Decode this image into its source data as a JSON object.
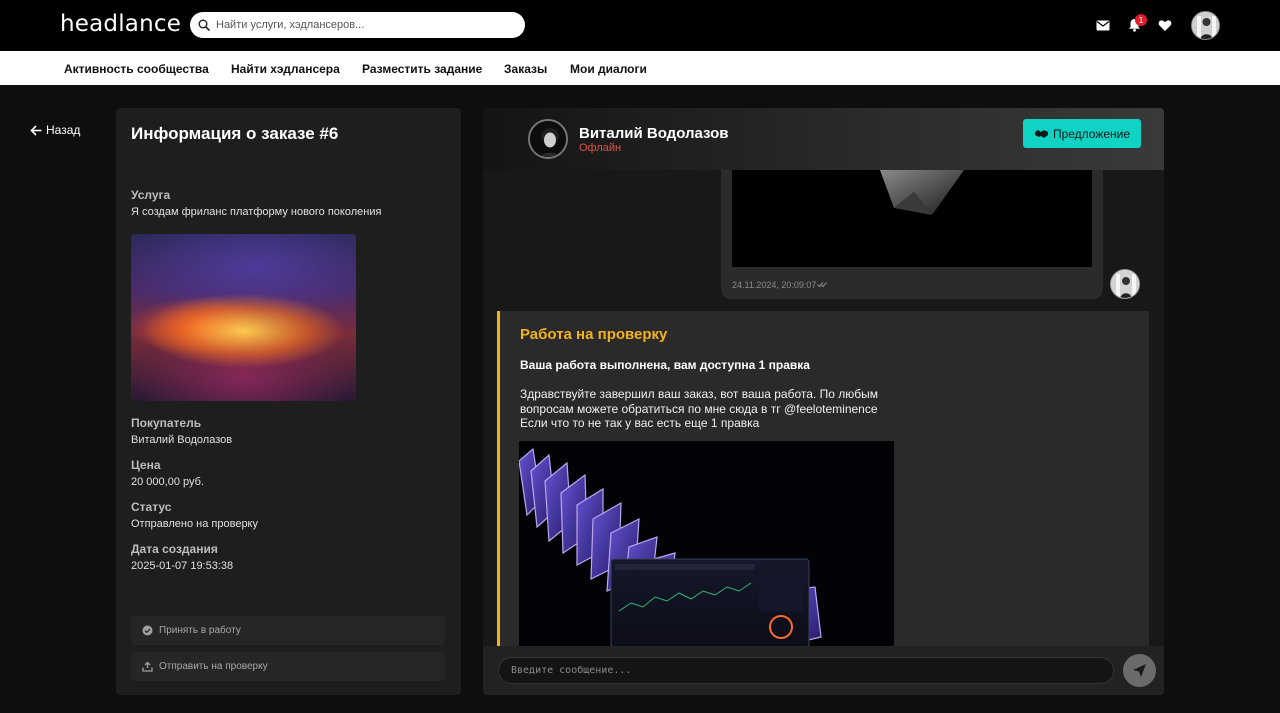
{
  "header": {
    "logo": "headlance",
    "search_placeholder": "Найти услуги, хэдлансеров...",
    "notification_count": "1",
    "icons": [
      "mail-icon",
      "bell-icon",
      "heart-icon",
      "user-avatar"
    ]
  },
  "nav": {
    "items": [
      {
        "label": "Активность сообщества"
      },
      {
        "label": "Найти хэдлансера"
      },
      {
        "label": "Разместить задание"
      },
      {
        "label": "Заказы"
      },
      {
        "label": "Мои диалоги"
      }
    ]
  },
  "back_label": "Назад",
  "order": {
    "title": "Информация о заказе #6",
    "service_label": "Услуга",
    "service_value": "Я создам фриланс платформу нового поколения",
    "buyer_label": "Покупатель",
    "buyer_value": "Виталий Водолазов",
    "price_label": "Цена",
    "price_value": "20 000,00 руб.",
    "status_label": "Статус",
    "status_value": "Отправлено на проверку",
    "date_label": "Дата создания",
    "date_value": "2025-01-07 19:53:38",
    "accept_button": "Принять в работу",
    "submit_button": "Отправить на проверку"
  },
  "chat": {
    "name": "Виталий Водолазов",
    "status": "Офлайн",
    "offer_button": "Предложение",
    "prev_message_time": "24.11.2024, 20:09:07",
    "review": {
      "title": "Работа на проверку",
      "subtitle": "Ваша работа выполнена, вам доступна 1 правка",
      "body_lines": [
        "Здравствуйте завершил ваш заказ, вот ваша работа. По любым",
        "вопросам можете обратиться по мне сюда в тг @feeloteminence",
        "Если что то не так у вас есть еще 1 правка"
      ]
    },
    "input_placeholder": "Введите сообщение..."
  },
  "colors": {
    "accent_teal": "#11d3c4",
    "review_yellow": "#f2b21a",
    "offline_red": "#e0533f",
    "badge_red": "#e01e2b"
  }
}
